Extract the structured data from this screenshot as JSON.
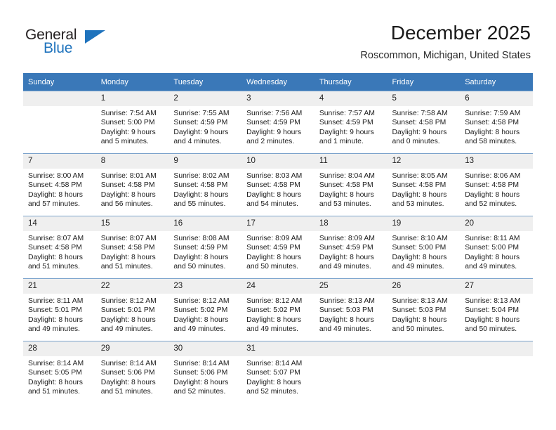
{
  "brand": {
    "name_part1": "General",
    "name_part2": "Blue",
    "triangle_color": "#1f73bd",
    "text_color": "#231f20"
  },
  "header": {
    "title": "December 2025",
    "subtitle": "Roscommon, Michigan, United States",
    "header_bg_color": "#3a78b8",
    "daynum_bg_color": "#efefef",
    "row_divider_color": "#7ba3cc"
  },
  "weekday_headers": [
    "Sunday",
    "Monday",
    "Tuesday",
    "Wednesday",
    "Thursday",
    "Friday",
    "Saturday"
  ],
  "weeks": [
    [
      {
        "day": "",
        "sunrise": "",
        "sunset": "",
        "daylight1": "",
        "daylight2": "",
        "empty": true
      },
      {
        "day": "1",
        "sunrise": "Sunrise: 7:54 AM",
        "sunset": "Sunset: 5:00 PM",
        "daylight1": "Daylight: 9 hours",
        "daylight2": "and 5 minutes."
      },
      {
        "day": "2",
        "sunrise": "Sunrise: 7:55 AM",
        "sunset": "Sunset: 4:59 PM",
        "daylight1": "Daylight: 9 hours",
        "daylight2": "and 4 minutes."
      },
      {
        "day": "3",
        "sunrise": "Sunrise: 7:56 AM",
        "sunset": "Sunset: 4:59 PM",
        "daylight1": "Daylight: 9 hours",
        "daylight2": "and 2 minutes."
      },
      {
        "day": "4",
        "sunrise": "Sunrise: 7:57 AM",
        "sunset": "Sunset: 4:59 PM",
        "daylight1": "Daylight: 9 hours",
        "daylight2": "and 1 minute."
      },
      {
        "day": "5",
        "sunrise": "Sunrise: 7:58 AM",
        "sunset": "Sunset: 4:58 PM",
        "daylight1": "Daylight: 9 hours",
        "daylight2": "and 0 minutes."
      },
      {
        "day": "6",
        "sunrise": "Sunrise: 7:59 AM",
        "sunset": "Sunset: 4:58 PM",
        "daylight1": "Daylight: 8 hours",
        "daylight2": "and 58 minutes."
      }
    ],
    [
      {
        "day": "7",
        "sunrise": "Sunrise: 8:00 AM",
        "sunset": "Sunset: 4:58 PM",
        "daylight1": "Daylight: 8 hours",
        "daylight2": "and 57 minutes."
      },
      {
        "day": "8",
        "sunrise": "Sunrise: 8:01 AM",
        "sunset": "Sunset: 4:58 PM",
        "daylight1": "Daylight: 8 hours",
        "daylight2": "and 56 minutes."
      },
      {
        "day": "9",
        "sunrise": "Sunrise: 8:02 AM",
        "sunset": "Sunset: 4:58 PM",
        "daylight1": "Daylight: 8 hours",
        "daylight2": "and 55 minutes."
      },
      {
        "day": "10",
        "sunrise": "Sunrise: 8:03 AM",
        "sunset": "Sunset: 4:58 PM",
        "daylight1": "Daylight: 8 hours",
        "daylight2": "and 54 minutes."
      },
      {
        "day": "11",
        "sunrise": "Sunrise: 8:04 AM",
        "sunset": "Sunset: 4:58 PM",
        "daylight1": "Daylight: 8 hours",
        "daylight2": "and 53 minutes."
      },
      {
        "day": "12",
        "sunrise": "Sunrise: 8:05 AM",
        "sunset": "Sunset: 4:58 PM",
        "daylight1": "Daylight: 8 hours",
        "daylight2": "and 53 minutes."
      },
      {
        "day": "13",
        "sunrise": "Sunrise: 8:06 AM",
        "sunset": "Sunset: 4:58 PM",
        "daylight1": "Daylight: 8 hours",
        "daylight2": "and 52 minutes."
      }
    ],
    [
      {
        "day": "14",
        "sunrise": "Sunrise: 8:07 AM",
        "sunset": "Sunset: 4:58 PM",
        "daylight1": "Daylight: 8 hours",
        "daylight2": "and 51 minutes."
      },
      {
        "day": "15",
        "sunrise": "Sunrise: 8:07 AM",
        "sunset": "Sunset: 4:58 PM",
        "daylight1": "Daylight: 8 hours",
        "daylight2": "and 51 minutes."
      },
      {
        "day": "16",
        "sunrise": "Sunrise: 8:08 AM",
        "sunset": "Sunset: 4:59 PM",
        "daylight1": "Daylight: 8 hours",
        "daylight2": "and 50 minutes."
      },
      {
        "day": "17",
        "sunrise": "Sunrise: 8:09 AM",
        "sunset": "Sunset: 4:59 PM",
        "daylight1": "Daylight: 8 hours",
        "daylight2": "and 50 minutes."
      },
      {
        "day": "18",
        "sunrise": "Sunrise: 8:09 AM",
        "sunset": "Sunset: 4:59 PM",
        "daylight1": "Daylight: 8 hours",
        "daylight2": "and 49 minutes."
      },
      {
        "day": "19",
        "sunrise": "Sunrise: 8:10 AM",
        "sunset": "Sunset: 5:00 PM",
        "daylight1": "Daylight: 8 hours",
        "daylight2": "and 49 minutes."
      },
      {
        "day": "20",
        "sunrise": "Sunrise: 8:11 AM",
        "sunset": "Sunset: 5:00 PM",
        "daylight1": "Daylight: 8 hours",
        "daylight2": "and 49 minutes."
      }
    ],
    [
      {
        "day": "21",
        "sunrise": "Sunrise: 8:11 AM",
        "sunset": "Sunset: 5:01 PM",
        "daylight1": "Daylight: 8 hours",
        "daylight2": "and 49 minutes."
      },
      {
        "day": "22",
        "sunrise": "Sunrise: 8:12 AM",
        "sunset": "Sunset: 5:01 PM",
        "daylight1": "Daylight: 8 hours",
        "daylight2": "and 49 minutes."
      },
      {
        "day": "23",
        "sunrise": "Sunrise: 8:12 AM",
        "sunset": "Sunset: 5:02 PM",
        "daylight1": "Daylight: 8 hours",
        "daylight2": "and 49 minutes."
      },
      {
        "day": "24",
        "sunrise": "Sunrise: 8:12 AM",
        "sunset": "Sunset: 5:02 PM",
        "daylight1": "Daylight: 8 hours",
        "daylight2": "and 49 minutes."
      },
      {
        "day": "25",
        "sunrise": "Sunrise: 8:13 AM",
        "sunset": "Sunset: 5:03 PM",
        "daylight1": "Daylight: 8 hours",
        "daylight2": "and 49 minutes."
      },
      {
        "day": "26",
        "sunrise": "Sunrise: 8:13 AM",
        "sunset": "Sunset: 5:03 PM",
        "daylight1": "Daylight: 8 hours",
        "daylight2": "and 50 minutes."
      },
      {
        "day": "27",
        "sunrise": "Sunrise: 8:13 AM",
        "sunset": "Sunset: 5:04 PM",
        "daylight1": "Daylight: 8 hours",
        "daylight2": "and 50 minutes."
      }
    ],
    [
      {
        "day": "28",
        "sunrise": "Sunrise: 8:14 AM",
        "sunset": "Sunset: 5:05 PM",
        "daylight1": "Daylight: 8 hours",
        "daylight2": "and 51 minutes."
      },
      {
        "day": "29",
        "sunrise": "Sunrise: 8:14 AM",
        "sunset": "Sunset: 5:06 PM",
        "daylight1": "Daylight: 8 hours",
        "daylight2": "and 51 minutes."
      },
      {
        "day": "30",
        "sunrise": "Sunrise: 8:14 AM",
        "sunset": "Sunset: 5:06 PM",
        "daylight1": "Daylight: 8 hours",
        "daylight2": "and 52 minutes."
      },
      {
        "day": "31",
        "sunrise": "Sunrise: 8:14 AM",
        "sunset": "Sunset: 5:07 PM",
        "daylight1": "Daylight: 8 hours",
        "daylight2": "and 52 minutes."
      },
      {
        "day": "",
        "sunrise": "",
        "sunset": "",
        "daylight1": "",
        "daylight2": "",
        "empty": true
      },
      {
        "day": "",
        "sunrise": "",
        "sunset": "",
        "daylight1": "",
        "daylight2": "",
        "empty": true
      },
      {
        "day": "",
        "sunrise": "",
        "sunset": "",
        "daylight1": "",
        "daylight2": "",
        "empty": true
      }
    ]
  ]
}
